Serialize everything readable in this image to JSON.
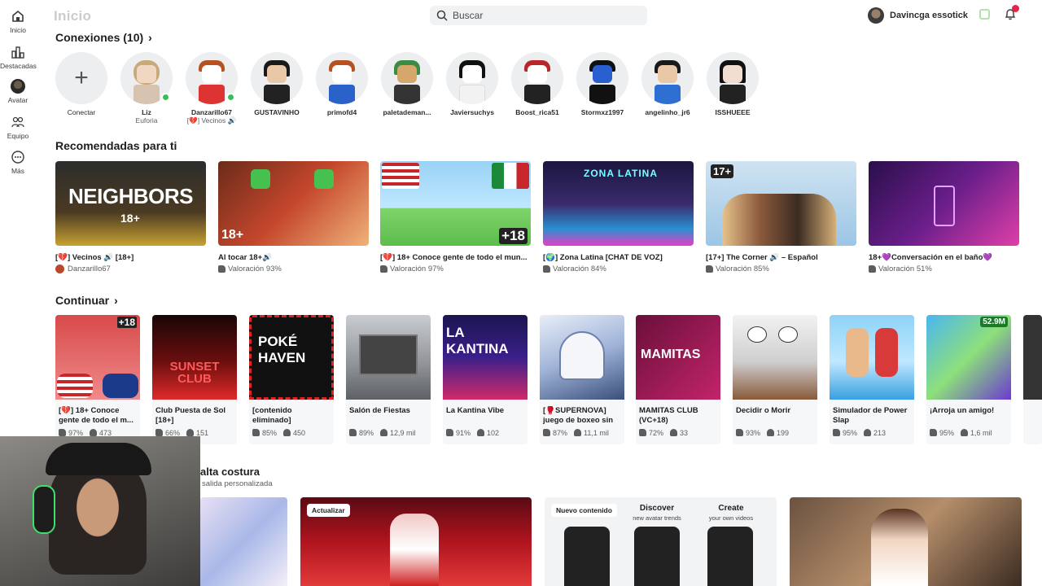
{
  "nav": {
    "items": [
      {
        "label": "Inicio",
        "icon": "home-icon"
      },
      {
        "label": "Destacadas",
        "icon": "charts-icon"
      },
      {
        "label": "Avatar",
        "icon": "avatar-icon"
      },
      {
        "label": "Equipo",
        "icon": "group-icon"
      },
      {
        "label": "Más",
        "icon": "more-icon"
      }
    ]
  },
  "header": {
    "title": "Inicio",
    "search_placeholder": "Buscar",
    "username": "Davincga essotick"
  },
  "connections": {
    "title": "Conexiones (10)",
    "add_label": "Conectar",
    "people": [
      {
        "name": "Liz",
        "status": "Euforia",
        "online": true
      },
      {
        "name": "Danzarillo67",
        "status": "[💔] Vecinos 🔊",
        "online": true
      },
      {
        "name": "GUSTAVINHO",
        "status": ""
      },
      {
        "name": "primofd4",
        "status": ""
      },
      {
        "name": "paletademan...",
        "status": ""
      },
      {
        "name": "Javiersuchys",
        "status": ""
      },
      {
        "name": "Boost_rica51",
        "status": ""
      },
      {
        "name": "Stormxz1997",
        "status": ""
      },
      {
        "name": "angelinho_jr6",
        "status": ""
      },
      {
        "name": "ISSHUEEE",
        "status": ""
      }
    ]
  },
  "recommended": {
    "title": "Recomendadas para ti",
    "cards": [
      {
        "title": "[💔] Vecinos 🔊 [18+]",
        "meta": "Danzarillo67",
        "thumb_text": "NEIGHBORS",
        "thumb_sub": "18+"
      },
      {
        "title": "Al tocar 18+🔊",
        "meta": "Valoración 93%",
        "thumb_text": "18+"
      },
      {
        "title": "[💔] 18+ Conoce gente de todo el mun...",
        "meta": "Valoración 97%",
        "thumb_text": "+18"
      },
      {
        "title": "[🌍] Zona Latina [CHAT DE VOZ]",
        "meta": "Valoración 84%",
        "thumb_text": "ZONA LATINA"
      },
      {
        "title": "[17+] The Corner 🔊 – Español",
        "meta": "Valoración 85%",
        "thumb_text": "17+"
      },
      {
        "title": "18+💜Conversación en el baño💜",
        "meta": "Valoración 51%",
        "thumb_text": ""
      }
    ]
  },
  "continue": {
    "title": "Continuar",
    "cards": [
      {
        "title": "[💔] 18+ Conoce gente de todo el m...",
        "rating": "97%",
        "players": "473",
        "thumb_text": "+18"
      },
      {
        "title": "Club Puesta de Sol [18+]",
        "rating": "66%",
        "players": "151",
        "thumb_text": "SUNSET CLUB"
      },
      {
        "title": "[contenido eliminado]",
        "rating": "85%",
        "players": "450",
        "thumb_text": "POKÉ HAVEN"
      },
      {
        "title": "Salón de Fiestas",
        "rating": "89%",
        "players": "12,9 mil",
        "thumb_text": ""
      },
      {
        "title": "La Kantina Vibe",
        "rating": "91%",
        "players": "102",
        "thumb_text": "LA KANTINA"
      },
      {
        "title": "[🥊SUPERNOVA] juego de boxeo sin ...",
        "rating": "87%",
        "players": "11,1 mil",
        "thumb_text": ""
      },
      {
        "title": "MAMITAS CLUB (VC+18)",
        "rating": "72%",
        "players": "33",
        "thumb_text": "MAMITAS"
      },
      {
        "title": "Decidir o Morir",
        "rating": "93%",
        "players": "199",
        "thumb_text": ""
      },
      {
        "title": "Simulador de Power Slap",
        "rating": "95%",
        "players": "213",
        "thumb_text": ""
      },
      {
        "title": "¡Arroja un amigo!",
        "rating": "95%",
        "players": "1,6 mil",
        "thumb_text": "52.9M"
      }
    ]
  },
  "bottom": {
    "title": "alta costura",
    "subtitle": "salida personalizada",
    "badges": [
      "Actualizar",
      "Nuevo contenido"
    ],
    "discover_title": "Discover",
    "discover_sub": "new avatar trends",
    "create_title": "Create",
    "create_sub": "your own videos"
  },
  "colors": {
    "online": "#3ebc5b",
    "badge": "#e5264b",
    "surface": "#f6f7f8"
  }
}
